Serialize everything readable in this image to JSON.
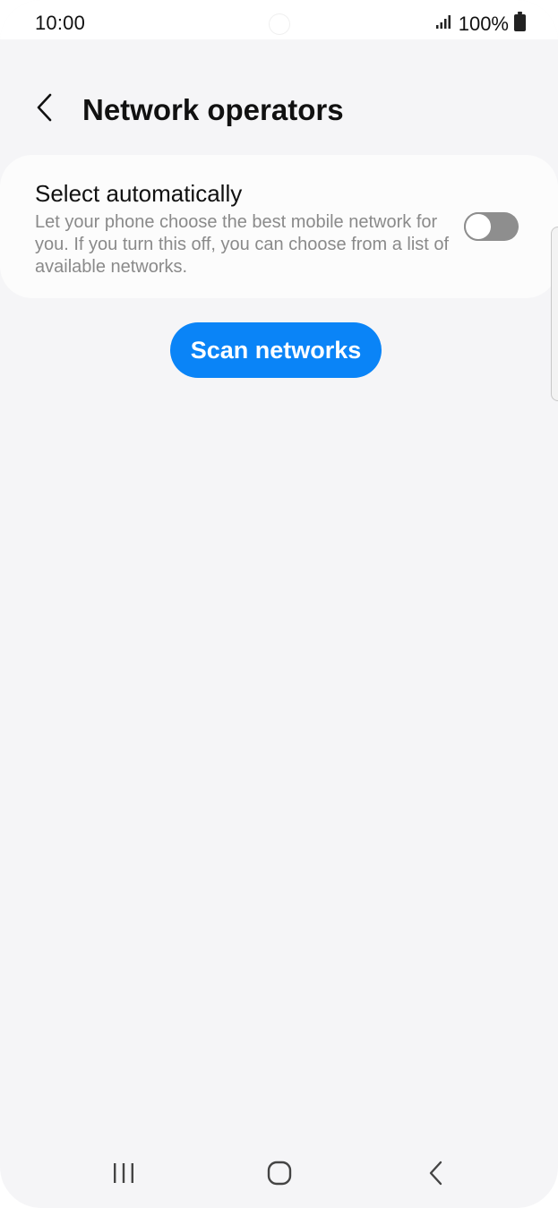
{
  "status_bar": {
    "time": "10:00",
    "battery": "100%",
    "signal_icon": "signal-bars-icon",
    "battery_icon": "battery-icon"
  },
  "header": {
    "title": "Network operators",
    "back_icon": "chevron-left-icon"
  },
  "select_automatically": {
    "title": "Select automatically",
    "description": "Let your phone choose the best mobile network for you. If you turn this off, you can choose from a list of available networks.",
    "enabled": false
  },
  "scan_button": {
    "label": "Scan networks"
  },
  "nav_bar": {
    "recent_icon": "recent-apps-icon",
    "home_icon": "home-icon",
    "back_icon": "back-icon"
  },
  "colors": {
    "accent": "#0a84f7",
    "background": "#f5f5f7",
    "card": "#fcfcfc",
    "toggle_off": "#8e8e8e",
    "secondary_text": "#8a8a8a"
  }
}
